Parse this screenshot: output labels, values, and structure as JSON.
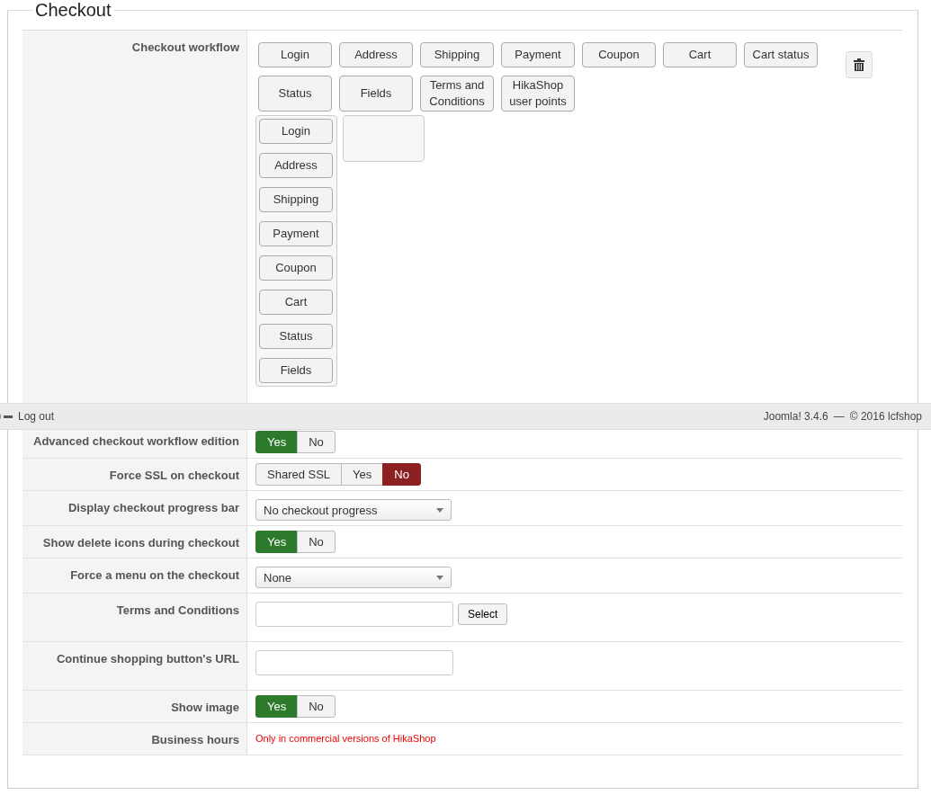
{
  "section": {
    "title": "Checkout"
  },
  "workflow": {
    "label": "Checkout workflow",
    "available": [
      "Login",
      "Address",
      "Shipping",
      "Payment",
      "Coupon",
      "Cart",
      "Cart status",
      "Status",
      "Fields",
      "Terms and Conditions",
      "HikaShop user points"
    ],
    "steps": [
      {
        "items": [
          "Login",
          "Address",
          "Shipping",
          "Payment",
          "Coupon",
          "Cart",
          "Status",
          "Fields"
        ]
      }
    ],
    "empty_drop_zone": true
  },
  "status_bar": {
    "logout": "Log out",
    "version": "Joomla! 3.4.6",
    "separator": "—",
    "copyright": "© 2016 lcfshop"
  },
  "rows": [
    {
      "label": "Advanced checkout workflow edition",
      "kind": "toggle",
      "options": [
        {
          "label": "Yes",
          "selected": true,
          "color": "#2d7a2d"
        },
        {
          "label": "No",
          "selected": false
        }
      ]
    },
    {
      "label": "Force SSL on checkout",
      "kind": "toggle",
      "options": [
        {
          "label": "Shared SSL",
          "selected": false
        },
        {
          "label": "Yes",
          "selected": false
        },
        {
          "label": "No",
          "selected": true,
          "color": "#8d2020"
        }
      ]
    },
    {
      "label": "Display checkout progress bar",
      "kind": "select",
      "value": "No checkout progress"
    },
    {
      "label": "Show delete icons during checkout",
      "kind": "toggle",
      "options": [
        {
          "label": "Yes",
          "selected": true,
          "color": "#2d7a2d"
        },
        {
          "label": "No",
          "selected": false
        }
      ]
    },
    {
      "label": "Force a menu on the checkout",
      "kind": "select",
      "value": "None"
    },
    {
      "label": "Terms and Conditions",
      "kind": "picker",
      "button": "Select"
    },
    {
      "label": "Continue shopping button's URL",
      "kind": "text"
    },
    {
      "label": "Show image",
      "kind": "toggle",
      "options": [
        {
          "label": "Yes",
          "selected": true,
          "color": "#2d7a2d"
        },
        {
          "label": "No",
          "selected": false
        }
      ]
    },
    {
      "label": "Business hours",
      "kind": "note",
      "note": "Only in commercial versions of HikaShop"
    }
  ]
}
